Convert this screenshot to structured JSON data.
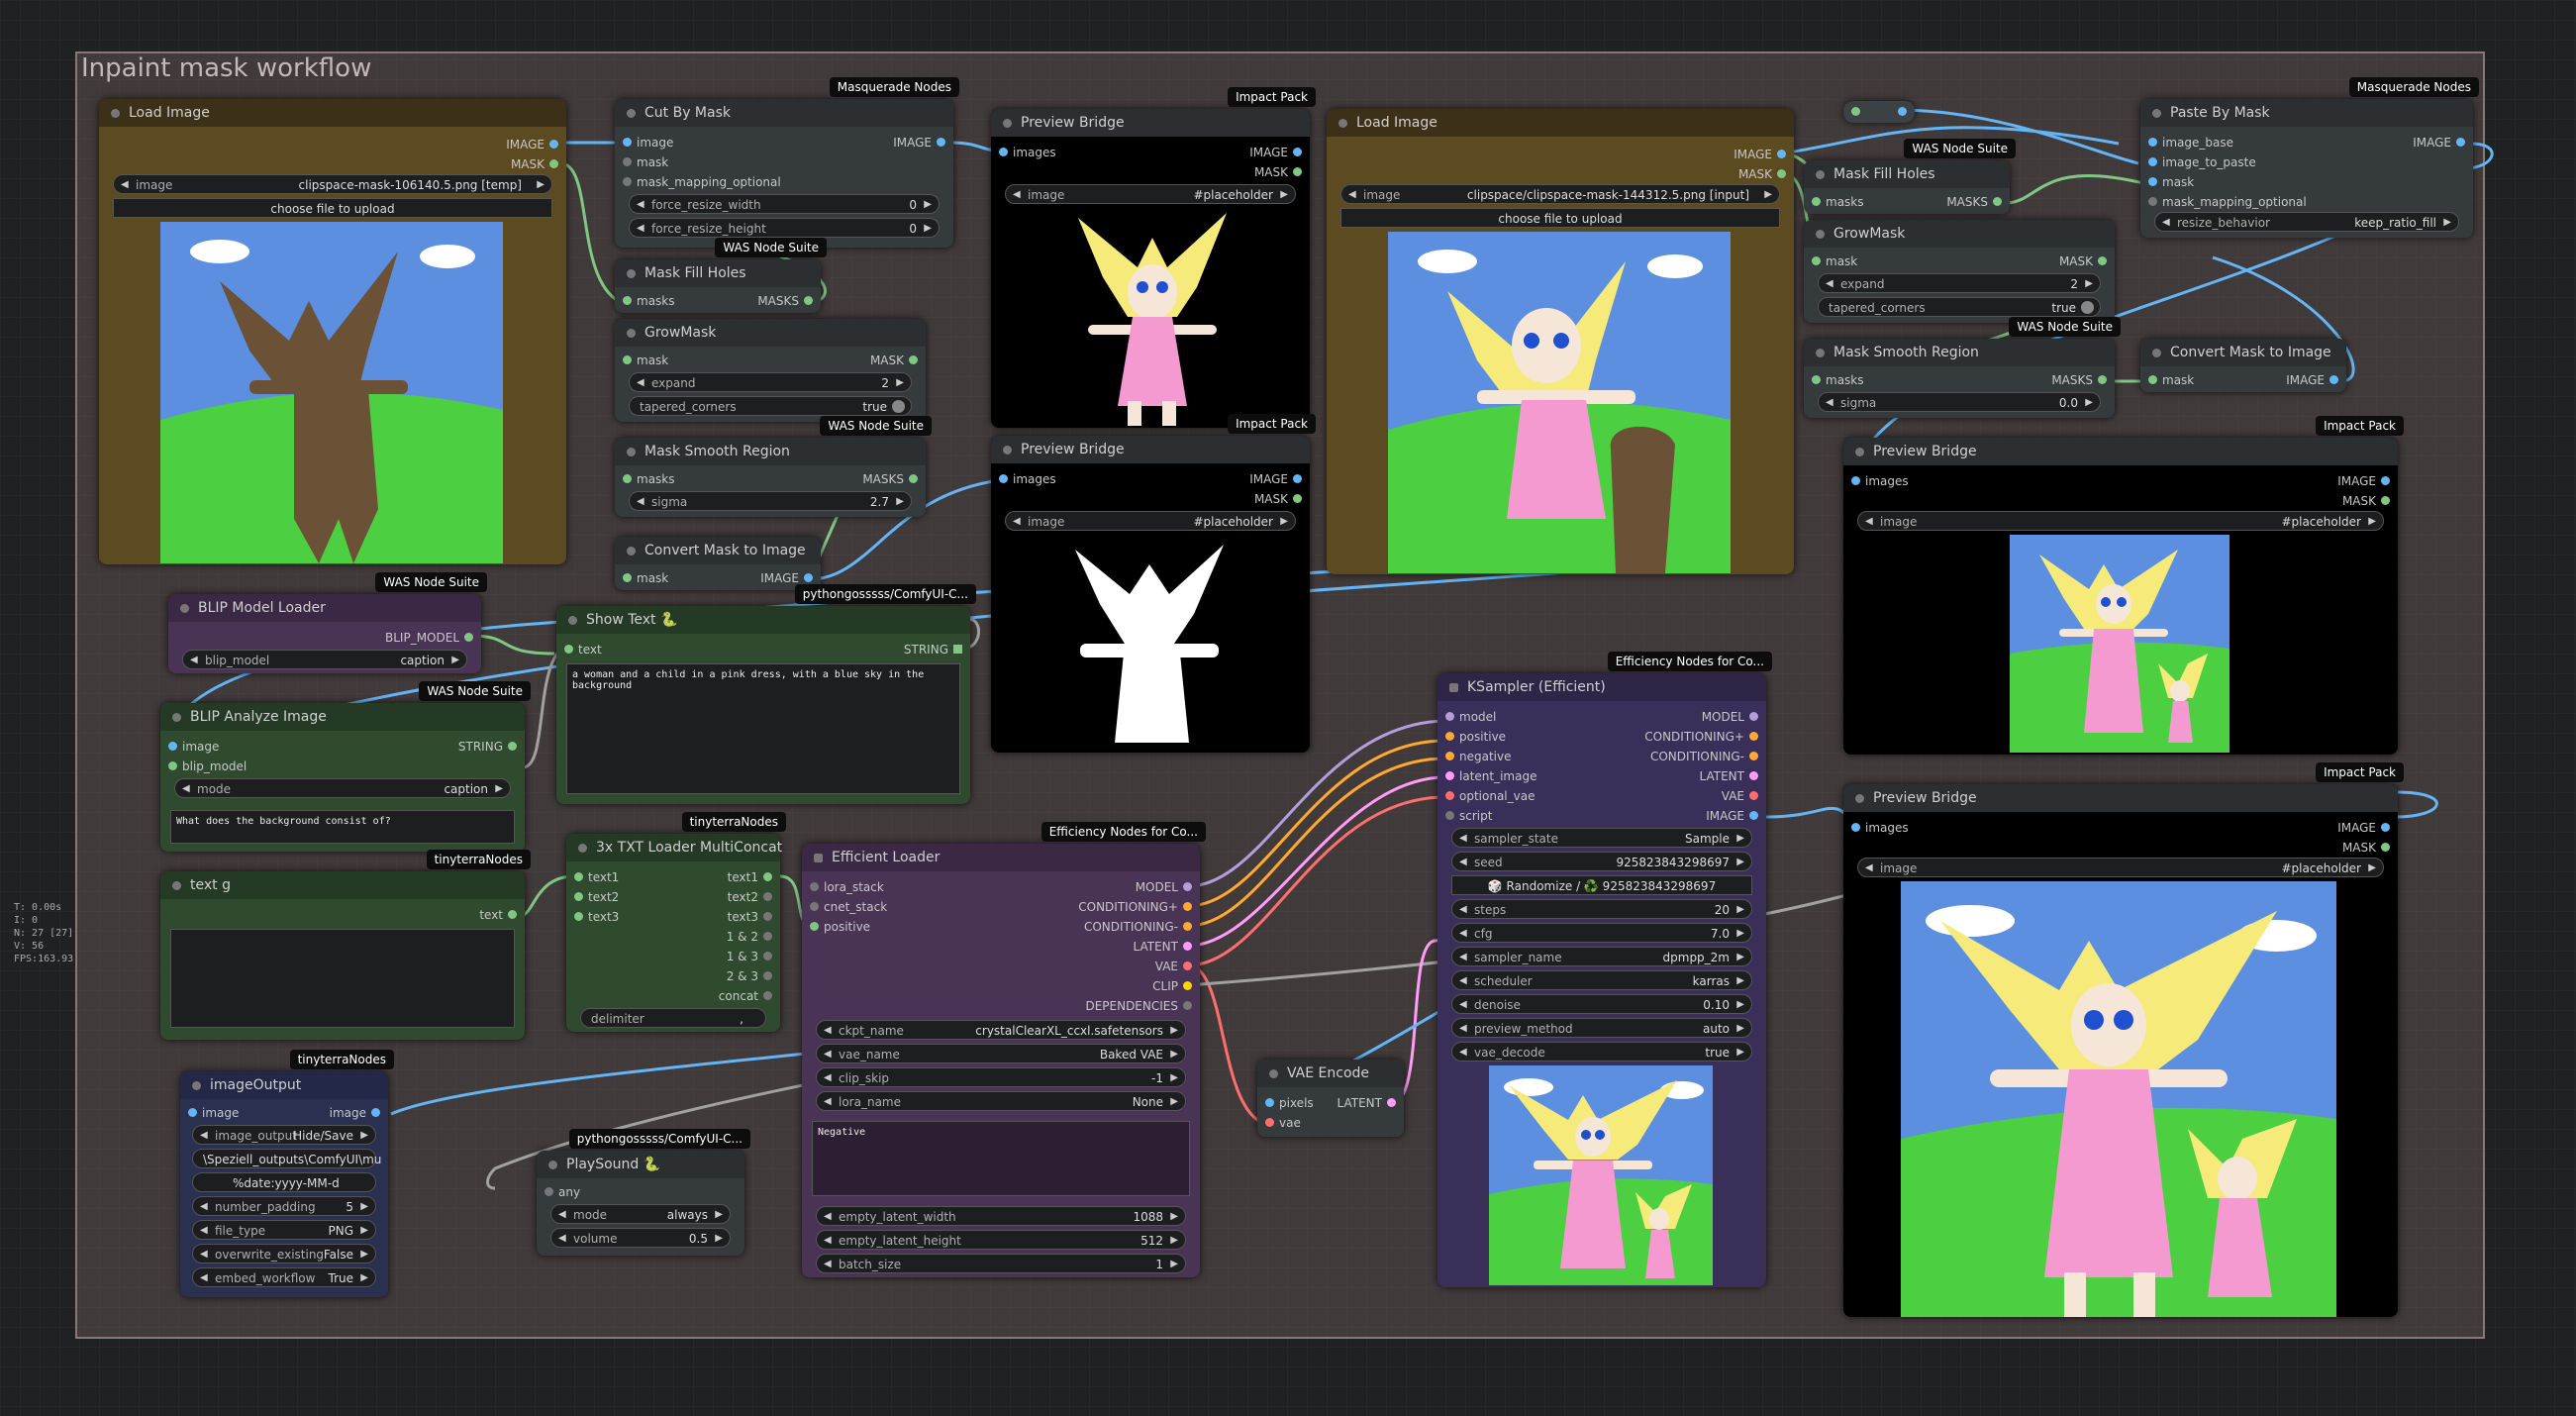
{
  "group": {
    "title": "Inpaint mask workflow"
  },
  "stats": {
    "t": "T: 0.00s",
    "i": "I: 0",
    "n": "N: 27 [27]",
    "v": "V: 56",
    "fps": "FPS:163.93"
  },
  "colors": {
    "background": "#1f2122",
    "group": "#705c5c",
    "image_wire": "#64b5f6",
    "mask_wire": "#81c784",
    "string_wire": "#a1a1a1",
    "model_wire": "#b39ddb",
    "conditioning_wire": "#ffa931",
    "latent_wire": "#ff9cf9",
    "vae_wire": "#ff6e6e"
  },
  "load_image_1": {
    "title": "Load Image",
    "out_image": "IMAGE",
    "out_mask": "MASK",
    "image_label": "image",
    "image_value": "clipspace-mask-106140.5.png [temp]",
    "upload": "choose file to upload"
  },
  "cut_by_mask": {
    "badge": "Masquerade Nodes",
    "title": "Cut By Mask",
    "in_image": "image",
    "in_mask": "mask",
    "in_mask_map": "mask_mapping_optional",
    "out_image": "IMAGE",
    "w1_label": "force_resize_width",
    "w1_value": "0",
    "w2_label": "force_resize_height",
    "w2_value": "0"
  },
  "mask_fill_1": {
    "badge": "WAS Node Suite",
    "title": "Mask Fill Holes",
    "in": "masks",
    "out": "MASKS"
  },
  "grow_mask_1": {
    "title": "GrowMask",
    "in": "mask",
    "out": "MASK",
    "w1_label": "expand",
    "w1_value": "2",
    "w2_label": "tapered_corners",
    "w2_value": "true"
  },
  "mask_smooth_1": {
    "badge": "WAS Node Suite",
    "title": "Mask Smooth Region",
    "in": "masks",
    "out": "MASKS",
    "w_label": "sigma",
    "w_value": "2.7"
  },
  "convert_mask_1": {
    "title": "Convert Mask to Image",
    "in": "mask",
    "out": "IMAGE"
  },
  "preview_1": {
    "badge": "Impact Pack",
    "title": "Preview Bridge",
    "in": "images",
    "out_image": "IMAGE",
    "out_mask": "MASK",
    "w_label": "image",
    "w_value": "#placeholder"
  },
  "preview_2": {
    "badge": "Impact Pack",
    "title": "Preview Bridge",
    "in": "images",
    "out_image": "IMAGE",
    "out_mask": "MASK",
    "w_label": "image",
    "w_value": "#placeholder"
  },
  "load_image_2": {
    "title": "Load Image",
    "out_image": "IMAGE",
    "out_mask": "MASK",
    "image_label": "image",
    "image_value": "clipspace/clipspace-mask-144312.5.png [input]",
    "upload": "choose file to upload"
  },
  "mask_fill_2": {
    "badge": "WAS Node Suite",
    "title": "Mask Fill Holes",
    "in": "masks",
    "out": "MASKS"
  },
  "grow_mask_2": {
    "title": "GrowMask",
    "in": "mask",
    "out": "MASK",
    "w1_label": "expand",
    "w1_value": "2",
    "w2_label": "tapered_corners",
    "w2_value": "true"
  },
  "mask_smooth_2": {
    "badge": "WAS Node Suite",
    "title": "Mask Smooth Region",
    "in": "masks",
    "out": "MASKS",
    "w_label": "sigma",
    "w_value": "0.0"
  },
  "paste_by_mask": {
    "badge": "Masquerade Nodes",
    "title": "Paste By Mask",
    "in1": "image_base",
    "in2": "image_to_paste",
    "in3": "mask",
    "in4": "mask_mapping_optional",
    "out": "IMAGE",
    "w_label": "resize_behavior",
    "w_value": "keep_ratio_fill"
  },
  "convert_mask_2": {
    "title": "Convert Mask to Image",
    "in": "mask",
    "out": "IMAGE"
  },
  "preview_3": {
    "badge": "Impact Pack",
    "title": "Preview Bridge",
    "in": "images",
    "out_image": "IMAGE",
    "out_mask": "MASK",
    "w_label": "image",
    "w_value": "#placeholder"
  },
  "preview_4": {
    "badge": "Impact Pack",
    "title": "Preview Bridge",
    "in": "images",
    "out_image": "IMAGE",
    "out_mask": "MASK",
    "w_label": "image",
    "w_value": "#placeholder"
  },
  "blip_loader": {
    "badge": "WAS Node Suite",
    "title": "BLIP Model Loader",
    "out": "BLIP_MODEL",
    "w_label": "blip_model",
    "w_value": "caption"
  },
  "blip_analyze": {
    "badge": "WAS Node Suite",
    "title": "BLIP Analyze Image",
    "in1": "image",
    "in2": "blip_model",
    "out": "STRING",
    "w_label": "mode",
    "w_value": "caption",
    "question": "What does the background consist of?"
  },
  "show_text": {
    "badge": "pythongosssss/ComfyUI-C...",
    "title": "Show Text",
    "in": "text",
    "out": "STRING",
    "content": "a woman and a child in a pink dress, with a blue sky in the background"
  },
  "text_g": {
    "badge": "tinyterraNodes",
    "title": "text g",
    "out": "text"
  },
  "txt_concat": {
    "badge": "tinyterraNodes",
    "title": "3x TXT Loader MultiConcat",
    "in1": "text1",
    "in2": "text2",
    "in3": "text3",
    "outs": [
      "text1",
      "text2",
      "text3",
      "1 & 2",
      "1 & 3",
      "2 & 3",
      "concat"
    ],
    "w_label": "delimiter",
    "w_value": ","
  },
  "efficient_loader": {
    "badge": "Efficiency Nodes for Co...",
    "title": "Efficient Loader",
    "in1": "lora_stack",
    "in2": "cnet_stack",
    "in3": "positive",
    "outs": [
      "MODEL",
      "CONDITIONING+",
      "CONDITIONING-",
      "LATENT",
      "VAE",
      "CLIP",
      "DEPENDENCIES"
    ],
    "widgets": [
      {
        "label": "ckpt_name",
        "value": "crystalClearXL_ccxl.safetensors"
      },
      {
        "label": "vae_name",
        "value": "Baked VAE"
      },
      {
        "label": "clip_skip",
        "value": "-1"
      },
      {
        "label": "lora_name",
        "value": "None"
      }
    ],
    "negative": "Negative",
    "widgets2": [
      {
        "label": "empty_latent_width",
        "value": "1088"
      },
      {
        "label": "empty_latent_height",
        "value": "512"
      },
      {
        "label": "batch_size",
        "value": "1"
      }
    ]
  },
  "image_output": {
    "badge": "tinyterraNodes",
    "title": "imageOutput",
    "in": "image",
    "out": "image",
    "widgets": [
      {
        "label": "image_output",
        "value": "Hide/Save"
      },
      {
        "label": "",
        "value": "\\Speziell_outputs\\ComfyUI\\mu"
      },
      {
        "label": "",
        "value": "%date:yyyy-MM-d"
      },
      {
        "label": "number_padding",
        "value": "5"
      },
      {
        "label": "file_type",
        "value": "PNG"
      },
      {
        "label": "overwrite_existing",
        "value": "False"
      },
      {
        "label": "embed_workflow",
        "value": "True"
      }
    ]
  },
  "play_sound": {
    "badge": "pythongosssss/ComfyUI-C...",
    "title": "PlaySound",
    "in": "any",
    "w1_label": "mode",
    "w1_value": "always",
    "w2_label": "volume",
    "w2_value": "0.5"
  },
  "ksampler": {
    "badge": "Efficiency Nodes for Co...",
    "title": "KSampler (Efficient)",
    "ins": [
      "model",
      "positive",
      "negative",
      "latent_image",
      "optional_vae",
      "script"
    ],
    "outs": [
      "MODEL",
      "CONDITIONING+",
      "CONDITIONING-",
      "LATENT",
      "VAE",
      "IMAGE"
    ],
    "widgets": [
      {
        "label": "sampler_state",
        "value": "Sample"
      },
      {
        "label": "seed",
        "value": "925823843298697"
      }
    ],
    "randomize": "🎲 Randomize / ♻️ 925823843298697",
    "widgets2": [
      {
        "label": "steps",
        "value": "20"
      },
      {
        "label": "cfg",
        "value": "7.0"
      },
      {
        "label": "sampler_name",
        "value": "dpmpp_2m"
      },
      {
        "label": "scheduler",
        "value": "karras"
      },
      {
        "label": "denoise",
        "value": "0.10"
      },
      {
        "label": "preview_method",
        "value": "auto"
      },
      {
        "label": "vae_decode",
        "value": "true"
      }
    ]
  },
  "vae_encode": {
    "title": "VAE Encode",
    "in1": "pixels",
    "in2": "vae",
    "out": "LATENT"
  }
}
